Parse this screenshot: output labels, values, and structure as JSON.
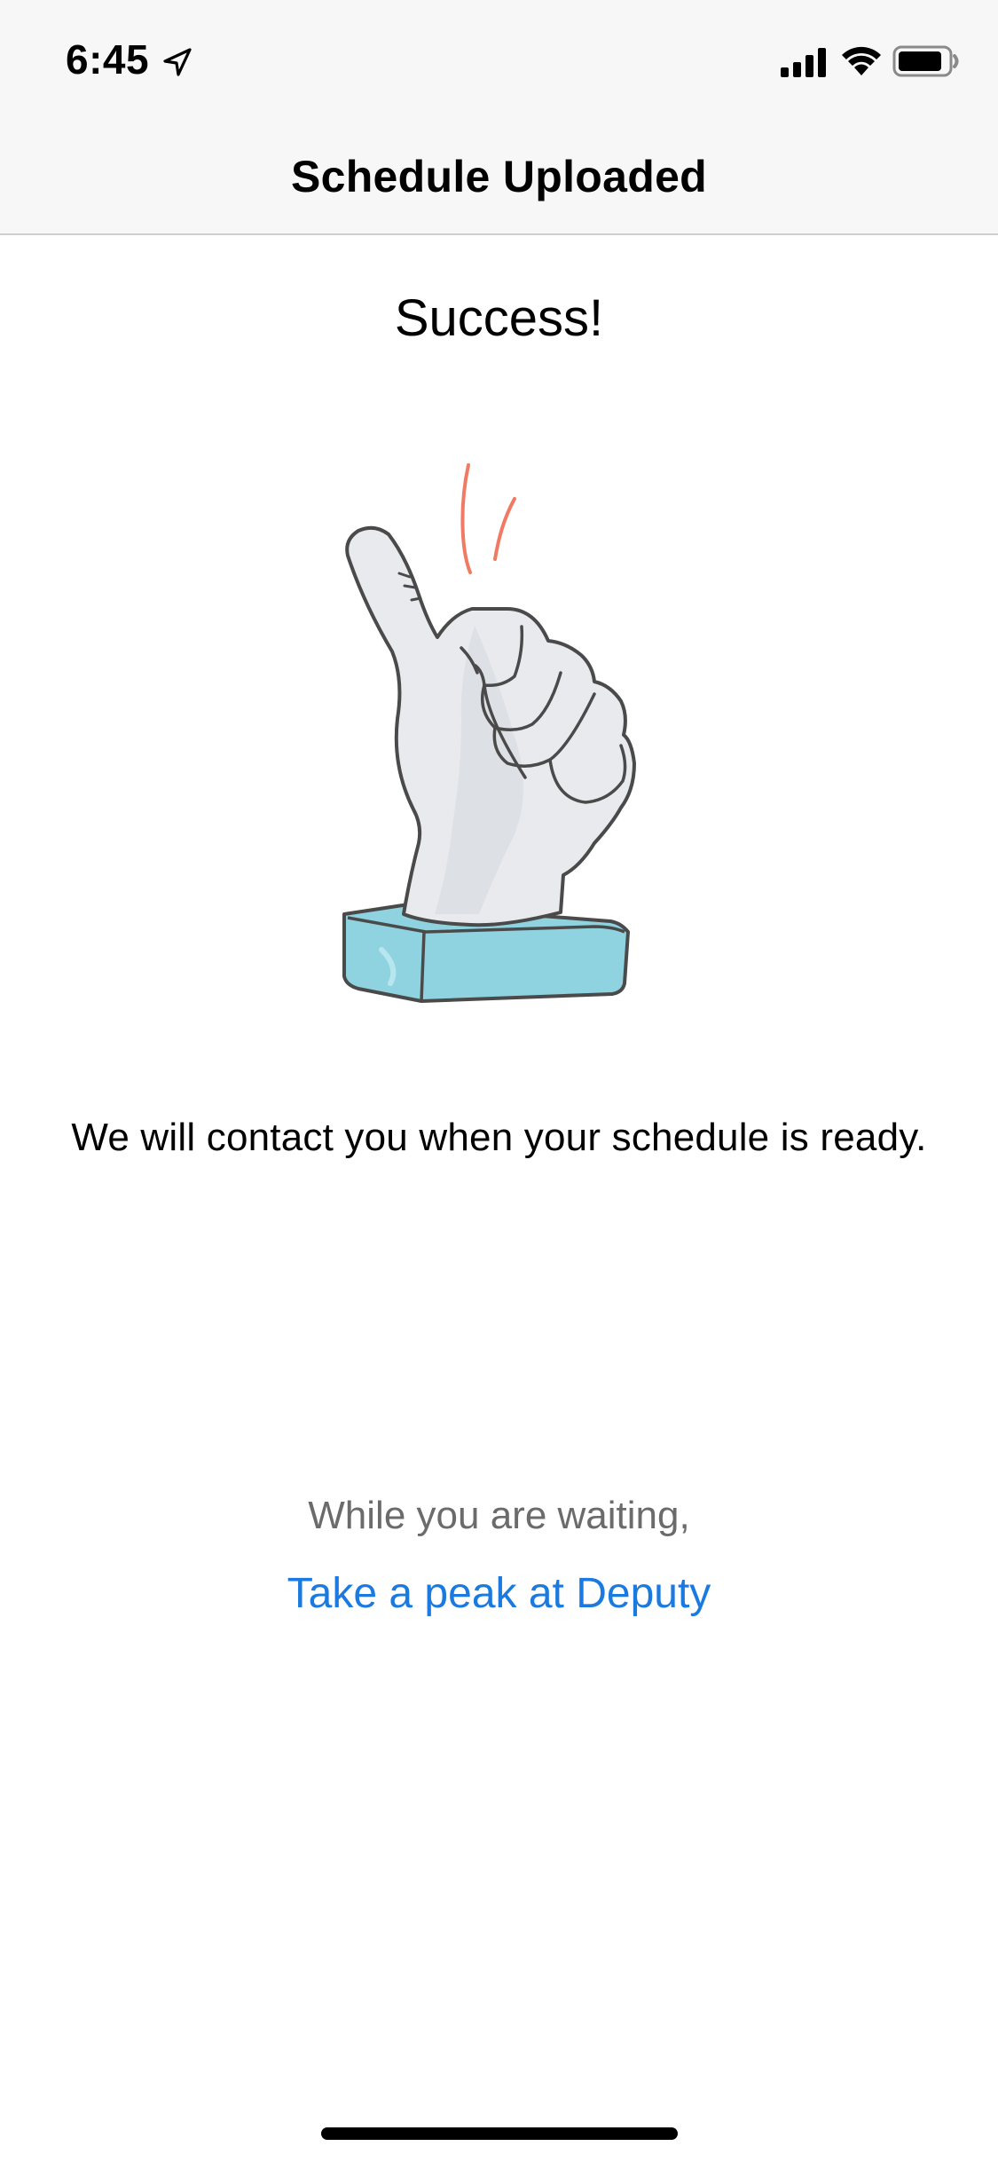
{
  "status_bar": {
    "time": "6:45",
    "icons": [
      "location-arrow-icon",
      "cellular-signal-icon",
      "wifi-icon",
      "battery-icon"
    ]
  },
  "nav": {
    "title": "Schedule Uploaded"
  },
  "content": {
    "heading": "Success!",
    "illustration": "thumbs-up-trophy-illustration",
    "message": "We will contact you when your schedule is ready.",
    "waiting_text": "While you are waiting,",
    "link_label": "Take a peak at Deputy"
  },
  "colors": {
    "link": "#1a7ae0",
    "nav_background": "#f7f7f7",
    "pedestal": "#8fd3e0",
    "hand": "#e8eaee",
    "accent_lines": "#f07a63"
  }
}
